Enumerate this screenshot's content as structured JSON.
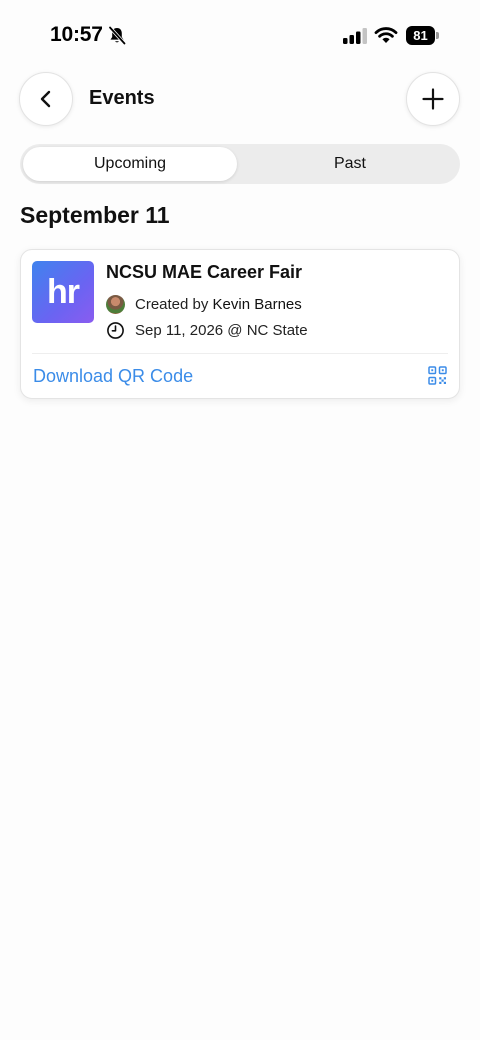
{
  "status_bar": {
    "time": "10:57",
    "battery_level": "81",
    "icons": [
      "bell-off-icon",
      "signal-icon",
      "wifi-icon",
      "battery-icon"
    ]
  },
  "header": {
    "title": "Events",
    "back_icon": "chevron-left-icon",
    "add_icon": "plus-icon"
  },
  "tabs": [
    {
      "label": "Upcoming",
      "selected": true
    },
    {
      "label": "Past",
      "selected": false
    }
  ],
  "section": {
    "date_heading": "September 11"
  },
  "event": {
    "logo_text": "hr",
    "title": "NCSU MAE Career Fair",
    "created_by_prefix": "Created by",
    "created_by_name": "Kevin Barnes",
    "datetime_location": "Sep 11, 2026 @ NC State",
    "download_label": "Download QR Code"
  },
  "colors": {
    "accent_link": "#3b8ce8",
    "logo_gradient_start": "#3f83ee",
    "logo_gradient_end": "#8a5cf0"
  }
}
